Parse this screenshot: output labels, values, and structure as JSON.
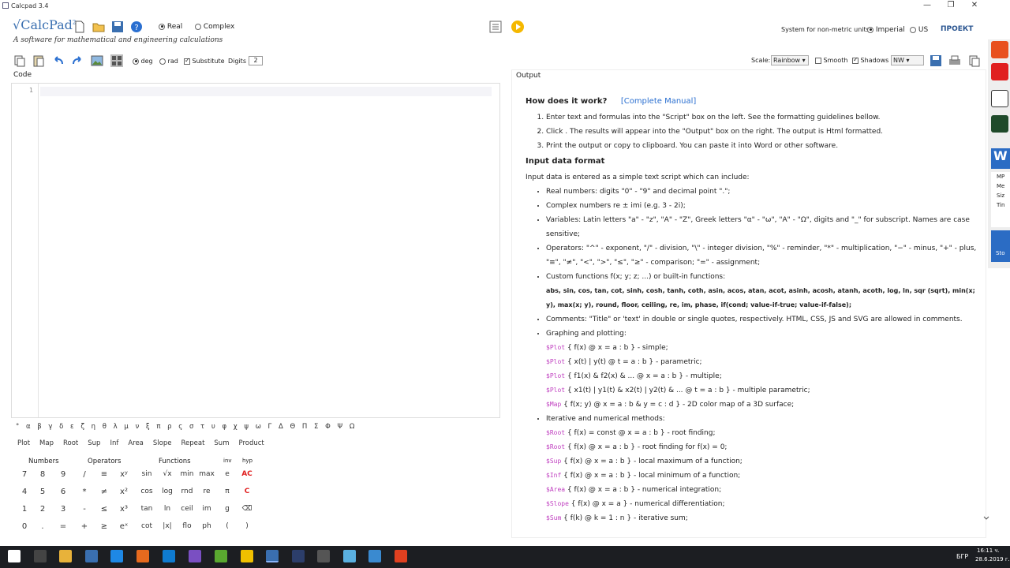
{
  "window": {
    "title": "Calcpad 3.4"
  },
  "app": {
    "logo": "√CalcPad",
    "logo_sup": "2",
    "tagline": "A software for mathematical and engineering calculations"
  },
  "mode": {
    "real_label": "Real",
    "complex_label": "Complex",
    "selected": "Real"
  },
  "units": {
    "label": "System for non-metric units:",
    "imperial": "Imperial",
    "us": "US",
    "selected": "Imperial",
    "brand": "ПРОЕКТ"
  },
  "toolbar2": {
    "deg": "deg",
    "rad": "rad",
    "substitute": "Substitute",
    "digits_label": "Digits",
    "digits_value": "2",
    "angle": "deg",
    "substitute_on": true
  },
  "output_toolbar": {
    "scale_label": "Scale:",
    "scale_value": "Rainbow",
    "smooth": "Smooth",
    "shadows": "Shadows",
    "shadows_on": true,
    "smooth_on": false,
    "light_value": "NW"
  },
  "code": {
    "label": "Code",
    "line_number": "1"
  },
  "output": {
    "label": "Output",
    "how_title": "How does it work?",
    "manual_link": "[Complete Manual]",
    "steps": [
      "Enter text and formulas into the \"Script\" box on the left. See the formatting guidelines bellow.",
      "Click . The results will appear into the \"Output\" box on the right. The output is Html formatted.",
      "Print  the output or copy  to clipboard. You can paste it into Word  or other software."
    ],
    "input_title": "Input data format",
    "input_intro": "Input data is entered as a simple text script which can include:",
    "items": [
      "Real numbers: digits \"0\" - \"9\" and decimal point \".\";",
      "Complex numbers re ± imi (e.g. 3 - 2i);",
      "Variables: Latin letters \"a\" - \"z\", \"A\" - \"Z\", Greek letters \"α\" - \"ω\", \"Α\" - \"Ω\", digits and \"_\" for subscript. Names are case sensitive;",
      "Operators: \"^\" - exponent, \"/\" - division, \"\\\" - integer division, \"%\" - reminder, \"*\" - multiplication, \"−\" - minus, \"+\" - plus, \"≡\", \"≠\", \"<\", \">\", \"≤\", \"≥\" - comparison; \"=\" - assignment;",
      "Custom functions f(x; y; z; ...) or built-in functions:",
      "abs, sin, cos, tan, cot, sinh, cosh, tanh, coth, asin, acos, atan, acot, asinh, acosh, atanh, acoth, log, ln, sqr (sqrt), min(x; y), max(x; y), round, floor, ceiling, re, im, phase, if(cond; value-if-true; value-if-false);",
      "Comments: \"Title\" or 'text' in double or single quotes, respectively. HTML, CSS, JS and SVG are allowed in comments.",
      "Graphing and plotting:"
    ],
    "plots": [
      {
        "k": "$Plot",
        "t": "{ f(x) @ x = a : b } - simple;"
      },
      {
        "k": "$Plot",
        "t": "{ x(t) | y(t) @ t = a : b } - parametric;"
      },
      {
        "k": "$Plot",
        "t": "{ f1(x) & f2(x) & ... @ x = a : b } - multiple;"
      },
      {
        "k": "$Plot",
        "t": "{ x1(t) | y1(t) & x2(t) | y2(t) & ... @ t = a : b } - multiple parametric;"
      },
      {
        "k": "$Map",
        "t": "{ f(x; y) @ x = a : b & y = c : d } - 2D color map of a 3D surface;"
      }
    ],
    "iter_title": "Iterative and numerical methods:",
    "iters": [
      {
        "k": "$Root",
        "t": "{ f(x) = const @ x = a : b } - root finding;"
      },
      {
        "k": "$Root",
        "t": "{ f(x) @ x = a : b } - root finding for f(x) = 0;"
      },
      {
        "k": "$Sup",
        "t": "{ f(x) @ x = a : b } - local maximum of a function;"
      },
      {
        "k": "$Inf",
        "t": "{ f(x) @ x = a : b } - local minimum of a function;"
      },
      {
        "k": "$Area",
        "t": "{ f(x) @ x = a : b } - numerical integration;"
      },
      {
        "k": "$Slope",
        "t": "{ f(x) @ x = a } - numerical differentiation;"
      },
      {
        "k": "$Sum",
        "t": "{ f(k) @ k = 1 : n } - iterative sum;"
      }
    ]
  },
  "keyboard": {
    "greek": "° α β γ δ ε ζ η θ λ μ ν ξ π ρ ς σ τ υ φ χ ψ ω Γ Δ Θ Π Σ Φ Ψ Ω",
    "func_row": [
      "Plot",
      "Map",
      "Root",
      "Sup",
      "Inf",
      "Area",
      "Slope",
      "Repeat",
      "Sum",
      "Product"
    ],
    "headers": [
      "Numbers",
      "Operators",
      "Functions",
      "inv",
      "hyp"
    ],
    "rows": [
      [
        "7",
        "8",
        "9",
        "/",
        "≡",
        "xʸ",
        "sin",
        "√x",
        "min",
        "max",
        "e",
        "AC"
      ],
      [
        "4",
        "5",
        "6",
        "*",
        "≠",
        "x²",
        "cos",
        "log",
        "rnd",
        "re",
        "π",
        "C"
      ],
      [
        "1",
        "2",
        "3",
        "-",
        "≤",
        "x³",
        "tan",
        "ln",
        "ceil",
        "im",
        "g",
        "⌫"
      ],
      [
        "0",
        ".",
        "=",
        "+",
        "≥",
        "eˣ",
        "cot",
        "|x|",
        "flo",
        "ph",
        "(",
        ")"
      ]
    ]
  },
  "taskbar": {
    "lang": "БГР",
    "time": "16:11 ч.",
    "date": "28.6.2019 г."
  },
  "sidebar": {
    "w_label": "W",
    "lines": [
      "MP",
      "Me",
      "Siz",
      "Tin"
    ],
    "stop": "Sto"
  },
  "colors": {
    "accent": "#3a6fb0",
    "run": "#f5b800",
    "keyword": "#c040c0",
    "ac": "#e02020"
  }
}
